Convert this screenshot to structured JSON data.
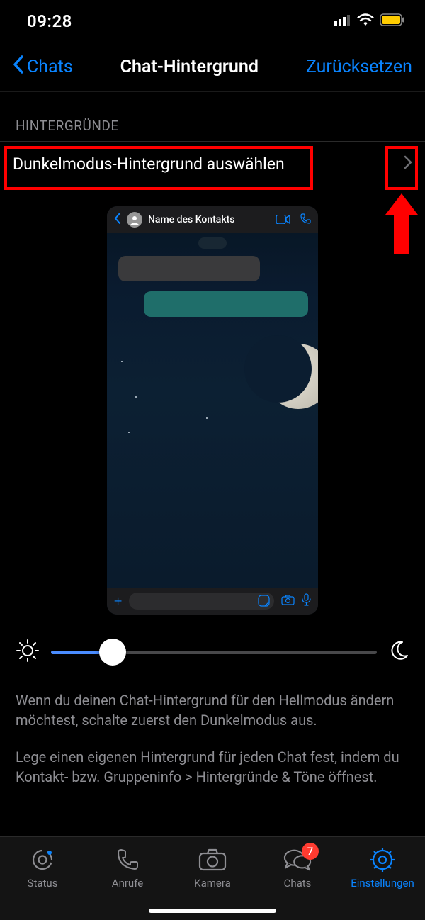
{
  "status": {
    "time": "09:28"
  },
  "nav": {
    "back_label": "Chats",
    "title": "Chat-Hintergrund",
    "reset_label": "Zurücksetzen"
  },
  "section": {
    "header": "HINTERGRÜNDE",
    "row_label": "Dunkelmodus-Hintergrund auswählen"
  },
  "preview": {
    "contact_name": "Name des Kontakts"
  },
  "slider": {
    "value_pct": 19
  },
  "help": {
    "p1": "Wenn du deinen Chat-Hintergrund für den Hellmodus ändern möchtest, schalte zuerst den Dunkelmodus aus.",
    "p2": "Lege einen eigenen Hintergrund für jeden Chat fest, indem du Kontakt- bzw. Gruppeninfo > Hintergründe & Töne öffnest."
  },
  "tabs": {
    "status": "Status",
    "calls": "Anrufe",
    "camera": "Kamera",
    "chats": "Chats",
    "settings": "Einstellungen",
    "chats_badge": "7"
  },
  "colors": {
    "accent": "#0a84ff",
    "highlight": "#ff0000"
  }
}
